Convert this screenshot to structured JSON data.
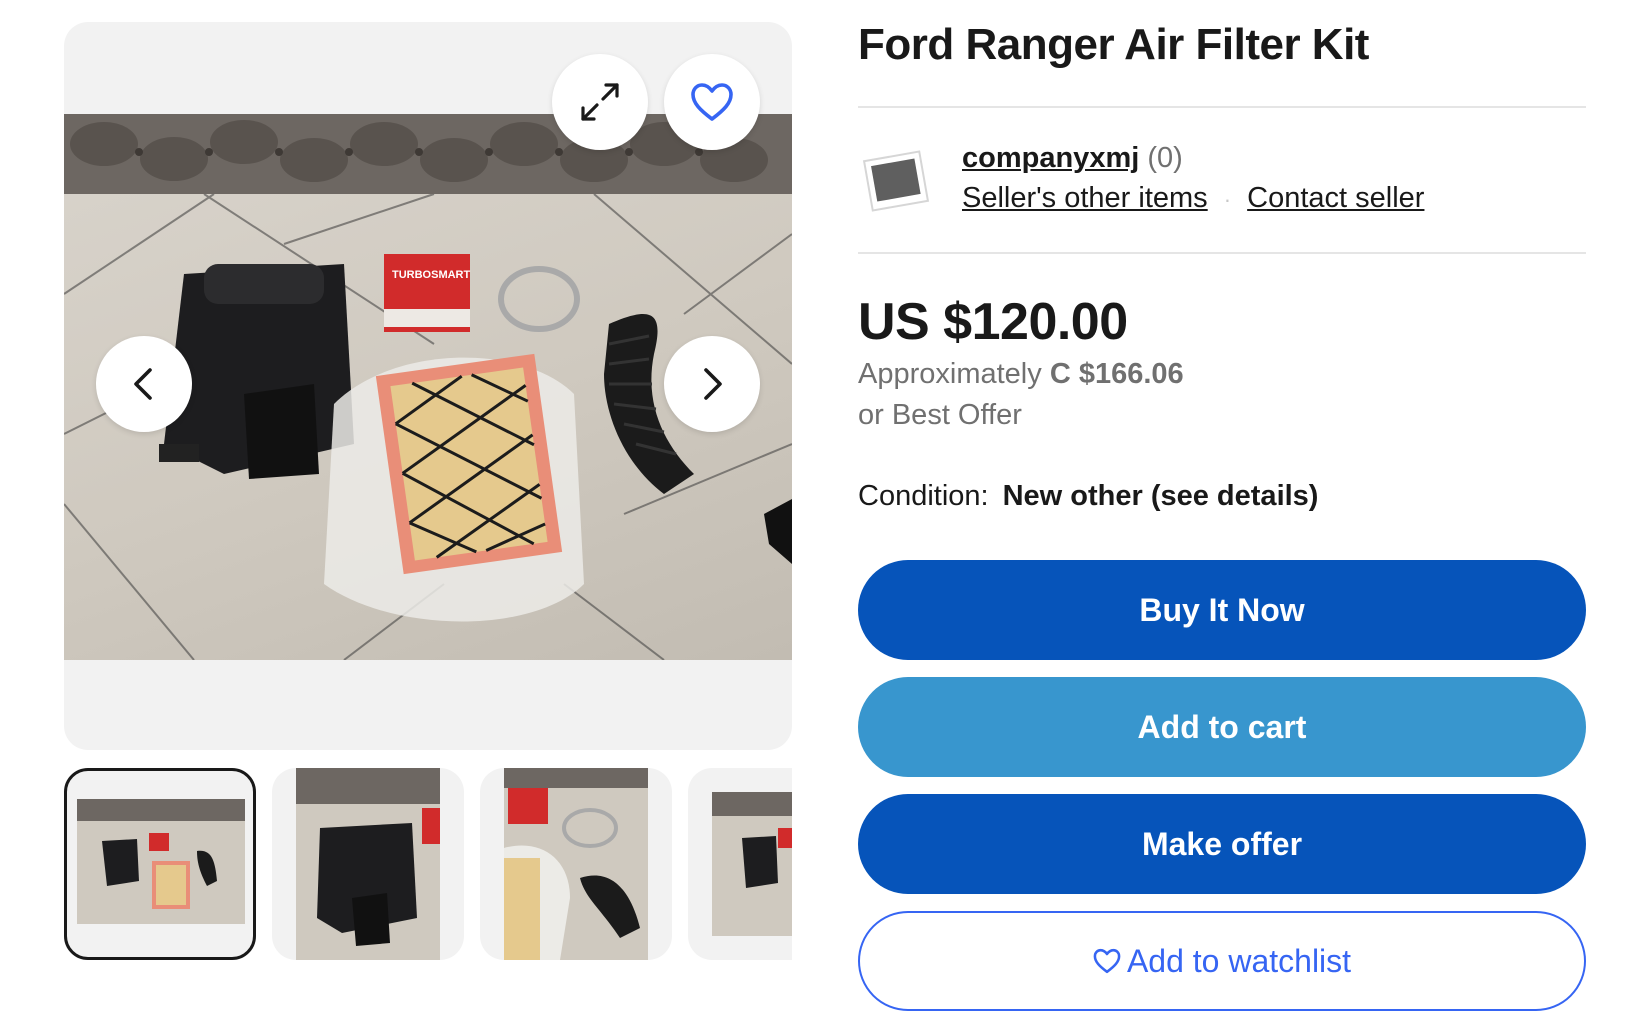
{
  "gallery": {
    "expand_icon": "expand-icon",
    "watch_icon": "heart-icon",
    "prev_icon": "chevron-left-icon",
    "next_icon": "chevron-right-icon",
    "main_image_brand_text": "TURBOSMART",
    "thumbnails": [
      {
        "selected": true
      },
      {
        "selected": false
      },
      {
        "selected": false
      },
      {
        "selected": false
      }
    ]
  },
  "listing": {
    "title": "Ford Ranger Air Filter Kit",
    "seller": {
      "name": "companyxmj",
      "feedback": "(0)",
      "other_items": "Seller's other items",
      "dot": "·",
      "contact": "Contact seller"
    },
    "price": "US $120.00",
    "approx_prefix": "Approximately ",
    "approx_value": "C $166.06",
    "offer_note": "or Best Offer",
    "condition_label": "Condition:",
    "condition_value": "New other (see details)"
  },
  "actions": {
    "buy_now": "Buy It Now",
    "add_to_cart": "Add to cart",
    "make_offer": "Make offer",
    "watchlist": "Add to watchlist"
  },
  "colors": {
    "primary_button": "#0654ba",
    "secondary_button": "#3896ce",
    "watchlist_blue": "#3665f3",
    "text": "#191919",
    "muted": "#707070"
  }
}
